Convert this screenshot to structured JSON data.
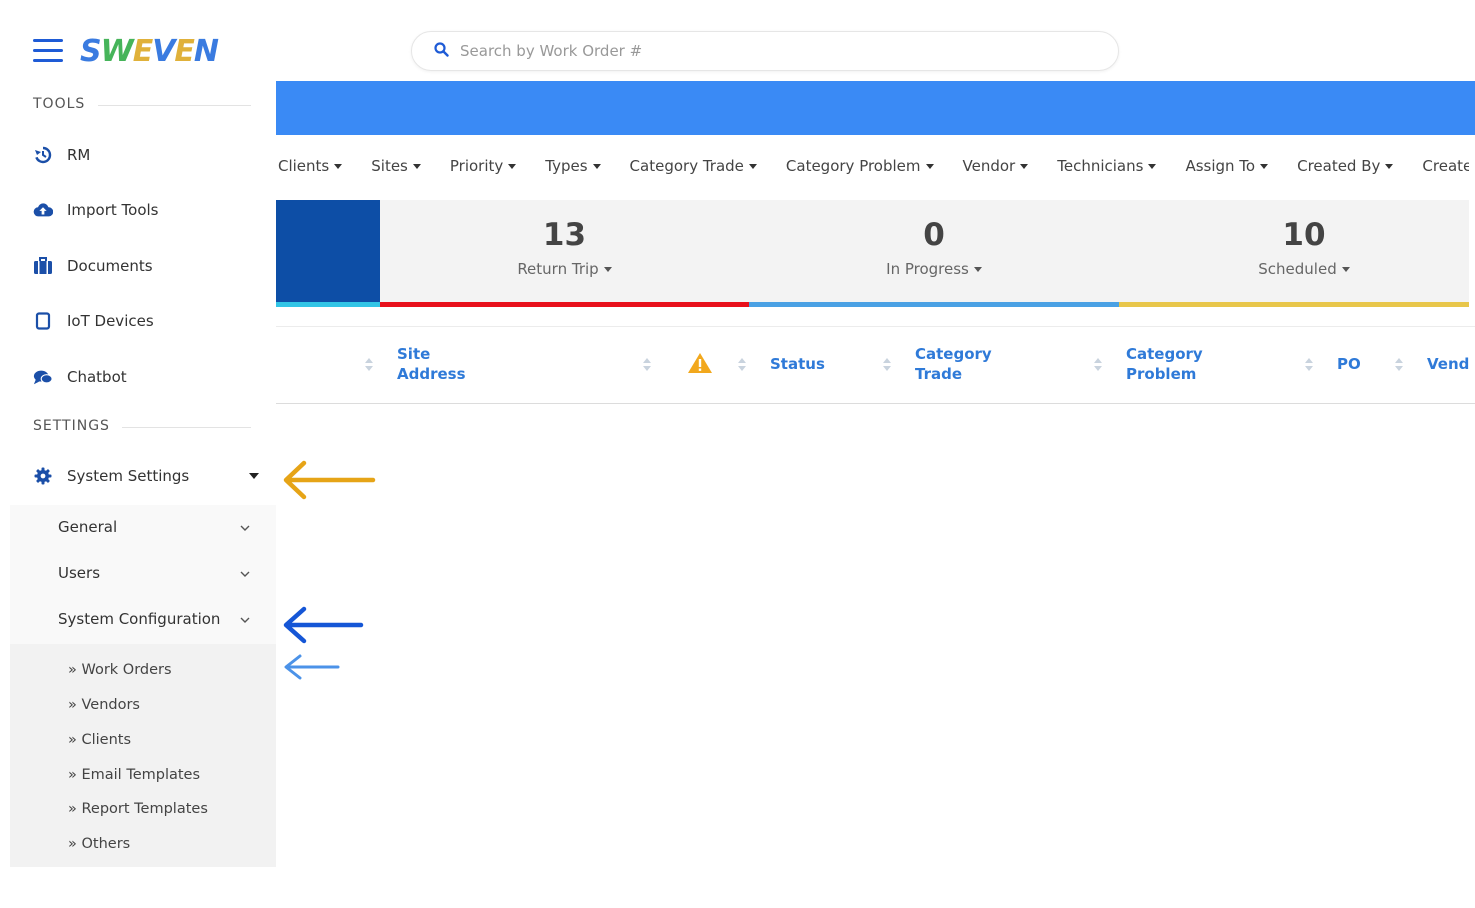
{
  "brand": {
    "logo_letters": [
      {
        "ch": "S",
        "color": "#3a7be0"
      },
      {
        "ch": "W",
        "color": "#46b45a"
      },
      {
        "ch": "E",
        "color": "#e0b13a"
      },
      {
        "ch": "V",
        "color": "#3a7be0"
      },
      {
        "ch": "E",
        "color": "#e0b13a"
      },
      {
        "ch": "N",
        "color": "#3a7be0"
      }
    ],
    "accent": "#3a8af5"
  },
  "sidebar": {
    "tools_title": "TOOLS",
    "tools": [
      {
        "label": "RM",
        "icon": "history-icon"
      },
      {
        "label": "Import Tools",
        "icon": "cloud-upload-icon"
      },
      {
        "label": "Documents",
        "icon": "briefcase-icon"
      },
      {
        "label": "IoT Devices",
        "icon": "tablet-icon"
      },
      {
        "label": "Chatbot",
        "icon": "chat-icon"
      }
    ],
    "settings_title": "SETTINGS",
    "system_settings": {
      "label": "System Settings",
      "icon": "gear-icon",
      "expanded": true
    },
    "submenu": [
      {
        "label": "General"
      },
      {
        "label": "Users"
      },
      {
        "label": "System Configuration"
      }
    ],
    "config_items": [
      {
        "label": "» Work Orders"
      },
      {
        "label": "» Vendors"
      },
      {
        "label": "» Clients"
      },
      {
        "label": "» Email Templates"
      },
      {
        "label": "» Report Templates"
      },
      {
        "label": "» Others"
      }
    ]
  },
  "search": {
    "placeholder": "Search by Work Order #",
    "value": ""
  },
  "filters": [
    "Clients",
    "Sites",
    "Priority",
    "Types",
    "Category Trade",
    "Category Problem",
    "Vendor",
    "Technicians",
    "Assign To",
    "Created By",
    "Created"
  ],
  "stats": [
    {
      "count": "13",
      "label": "Return Trip",
      "color": "#e8101b"
    },
    {
      "count": "0",
      "label": "In Progress",
      "color": "#4aa1e4"
    },
    {
      "count": "10",
      "label": "Scheduled",
      "color": "#e8c64a"
    }
  ],
  "table": {
    "columns": [
      {
        "line1": "Site",
        "line2": "Address"
      },
      {
        "line1": "",
        "line2": "",
        "icon": "warning-icon"
      },
      {
        "line1": "Status",
        "line2": ""
      },
      {
        "line1": "Category",
        "line2": "Trade"
      },
      {
        "line1": "Category",
        "line2": "Problem"
      },
      {
        "line1": "PO",
        "line2": ""
      },
      {
        "line1": "Vendor",
        "line2": ""
      }
    ]
  },
  "annotations": {
    "arrow_colors": [
      "#e6a417",
      "#1556d6",
      "#4b92e8"
    ]
  }
}
